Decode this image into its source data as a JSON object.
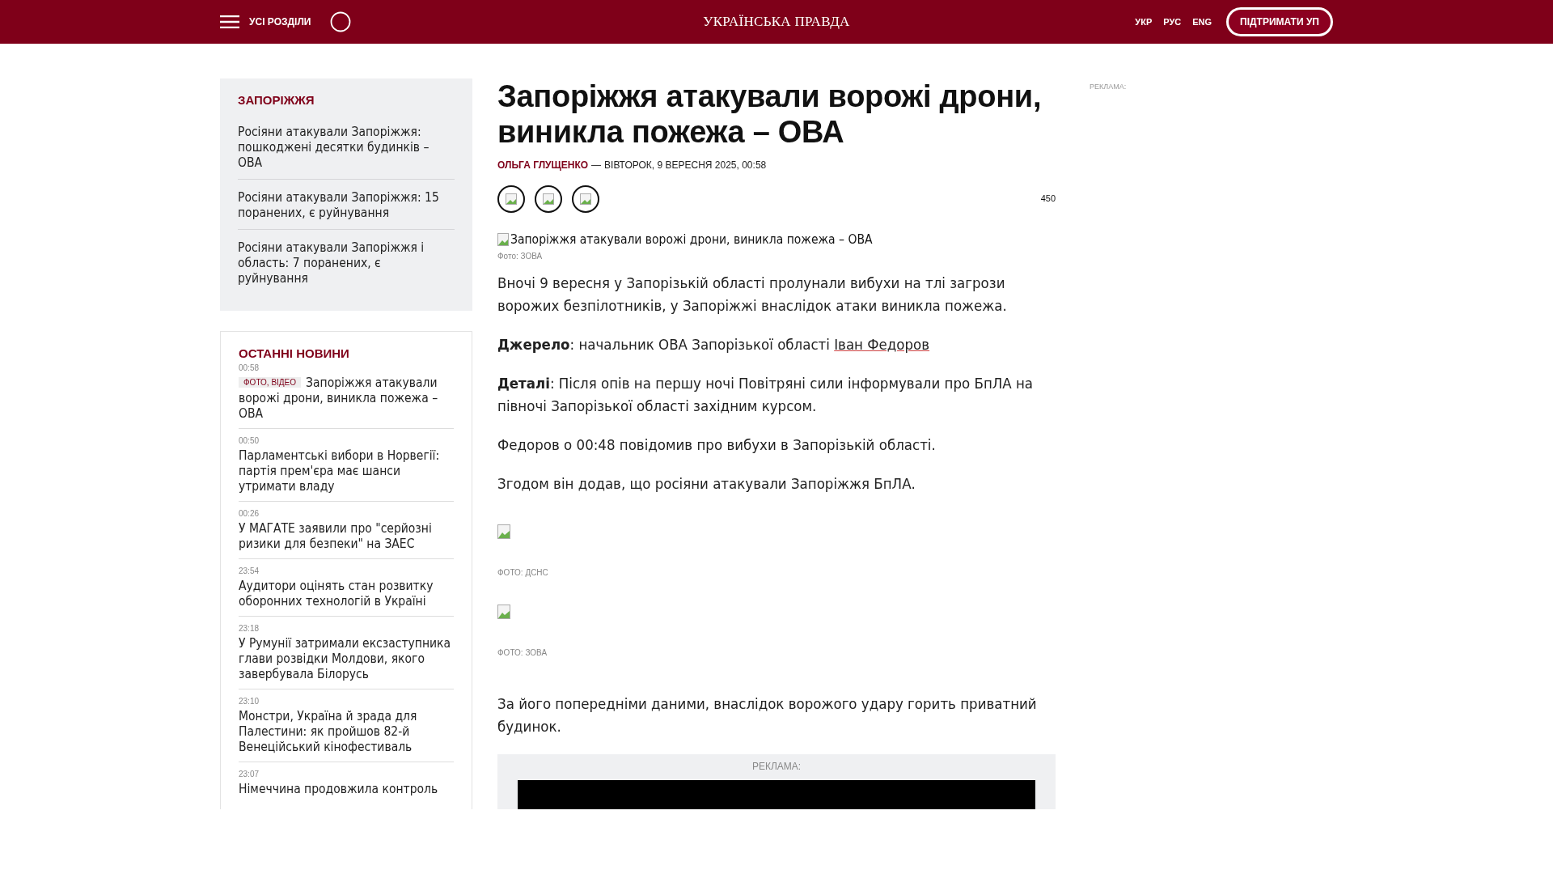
{
  "header": {
    "menu_label": "УСІ РОЗДІЛИ",
    "logo": "УКРАЇНСЬКА ПРАВДА",
    "languages": [
      "УКР",
      "РУС",
      "ENG"
    ],
    "support_button": "ПІДТРИМАТИ УП"
  },
  "related": {
    "title": "ЗАПОРІЖЖЯ",
    "items": [
      "Росіяни атакували Запоріжжя: пошкоджені десятки будинків – ОВА",
      "Росіяни атакували Запоріжжя: 15 поранених, є руйнування",
      "Росіяни атакували Запоріжжя і область: 7 поранених, є руйнування"
    ]
  },
  "latest": {
    "title": "ОСТАННІ НОВИНИ",
    "items": [
      {
        "time": "00:58",
        "tag": "ФОТО, ВІДЕО",
        "title": "Запоріжжя атакували ворожі дрони, виникла пожежа – ОВА"
      },
      {
        "time": "00:50",
        "title": "Парламентські вибори в Норвегії: партія прем'єра має шанси утримати владу"
      },
      {
        "time": "00:26",
        "title": "У МАГАТЕ заявили про \"серйозні ризики для безпеки\" на ЗАЕС"
      },
      {
        "time": "23:54",
        "title": "Аудитори оцінять стан розвитку оборонних технологій в Україні"
      },
      {
        "time": "23:18",
        "title": "У Румунії затримали ексзаступника глави розвідки Молдови, якого завербувала Білорусь"
      },
      {
        "time": "23:10",
        "title": "Монстри, Україна й зрада для Палестини: як пройшов 82-й Венеційський кінофестиваль"
      },
      {
        "time": "23:07",
        "title": "Німеччина продовжила контроль"
      }
    ]
  },
  "article": {
    "title": "Запоріжжя атакували ворожі дрони, виникла пожежа – ОВА",
    "author": "ОЛЬГА ГЛУЩЕНКО",
    "separator": "—",
    "date": "ВІВТОРОК, 9 ВЕРЕСНЯ 2025, 00:58",
    "share_count": "450",
    "image_alt": "Запоріжжя атакували ворожі дрони, виникла пожежа – ОВА",
    "image_caption": "Фото: ЗОВА",
    "body": [
      {
        "kind": "paragraph",
        "text": "Вночі 9 вересня у Запорізькій області пролунали вибухи на тлі загрози ворожих безпілотників, у Запоріжжі внаслідок атаки виникла пожежа."
      },
      {
        "kind": "paragraph",
        "text": "**Джерело**: начальник ОВА Запорізької області",
        "link": "Іван Федоров"
      },
      {
        "kind": "paragraph",
        "text": "**Деталі**: Після опів на першу ночі Повітряні сили інформували про БпЛА на півночі Запорізької області західним курсом."
      },
      {
        "kind": "paragraph",
        "text": "Федоров о 00:48 повідомив про вибухи в Запорізькій області."
      },
      {
        "kind": "paragraph",
        "text": "Згодом він додав, що росіяни атакували Запоріжжя БпЛА."
      },
      {
        "kind": "figure",
        "caption": "ФОТО: ДСНС"
      },
      {
        "kind": "figure",
        "caption": "ФОТО: ЗОВА"
      },
      {
        "kind": "paragraph",
        "text": "За його попередніми даними, внаслідок ворожого удару горить приватний будинок."
      },
      {
        "kind": "ad",
        "label": "РЕКЛАМА:"
      }
    ]
  },
  "side_ad_label": "РЕКЛАМА:"
}
